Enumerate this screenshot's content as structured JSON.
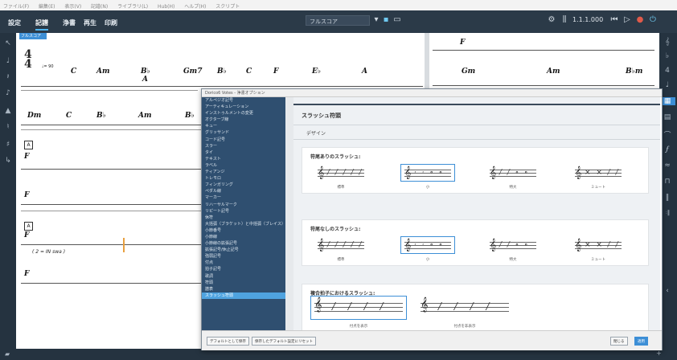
{
  "menubar": [
    "ファイル(F)",
    "編集(E)",
    "表示(V)",
    "記譜(N)",
    "ライブラリ(L)",
    "Hub(H)",
    "ヘルプ(H)",
    "スクリプト"
  ],
  "toolbar": {
    "modes": [
      "設定",
      "記譜",
      "浄書",
      "再生",
      "印刷"
    ],
    "active_mode": "記譜",
    "layout_select": "フルスコア",
    "counter": "1.1.1.000"
  },
  "layout_tag": "フルスコア",
  "score": {
    "chords_row1": [
      "C",
      "Am",
      "B♭",
      "Gm7",
      "B♭",
      "C",
      "F",
      "E♭",
      "A"
    ],
    "slash_label_a": "B♭",
    "slash_label_b": "A",
    "chords_row2": [
      "Dm",
      "C",
      "B♭",
      "Am",
      "B♭"
    ],
    "dyn": [
      "F",
      "F",
      "F",
      "F",
      "F"
    ],
    "lyric_line": "( 2 = IN swa )",
    "right_chords": [
      "Gm",
      "Am",
      "B♭m"
    ],
    "time_sig_top": "4",
    "time_sig_bottom": "4",
    "tempo": "♩= 90"
  },
  "dialog": {
    "title": "Dorico6 Votes - 浄書オプション",
    "nav": [
      "アルペジオ記号",
      "アーティキュレーション",
      "インストゥルメントの変更",
      "オクターブ線",
      "キュー",
      "グリッサンド",
      "コード記号",
      "スラー",
      "タイ",
      "テキスト",
      "ラベル",
      "ティアンジ",
      "トレモロ",
      "フィンガリング",
      "ペダル線",
      "マーカー",
      "リハーサルマーク",
      "リピート記号",
      "休符",
      "大括弧（ブラケット）と中括弧（ブレイス）",
      "小節番号",
      "小節線",
      "小節線の拡張記号",
      "拡張記号/休止記号",
      "強弱記号",
      "付点",
      "拍子記号",
      "歌詞",
      "符頭",
      "譜表"
    ],
    "selected_nav": "スラッシュ符頭",
    "page_title": "スラッシュ符頭",
    "page_sub": "デザイン",
    "sec1_title": "符尾ありのスラッシュ:",
    "sec1_options": [
      "標準",
      "小",
      "特大",
      "ミュート"
    ],
    "sec2_title": "符尾なしのスラッシュ:",
    "sec2_options": [
      "標準",
      "小",
      "特大",
      "ミュート"
    ],
    "sec3_title": "複合拍子におけるスラッシュ:",
    "sec3_options": [
      "付点を表示",
      "付点を非表示"
    ],
    "footer_reset": "デフォルトとして保存",
    "footer_default": "保存したデフォルト設定にリセット",
    "close": "閉じる",
    "apply": "適用"
  },
  "colors": {
    "toolbar": "#2b3a48",
    "accent": "#3d8fd6",
    "nav": "#2f4f70"
  }
}
